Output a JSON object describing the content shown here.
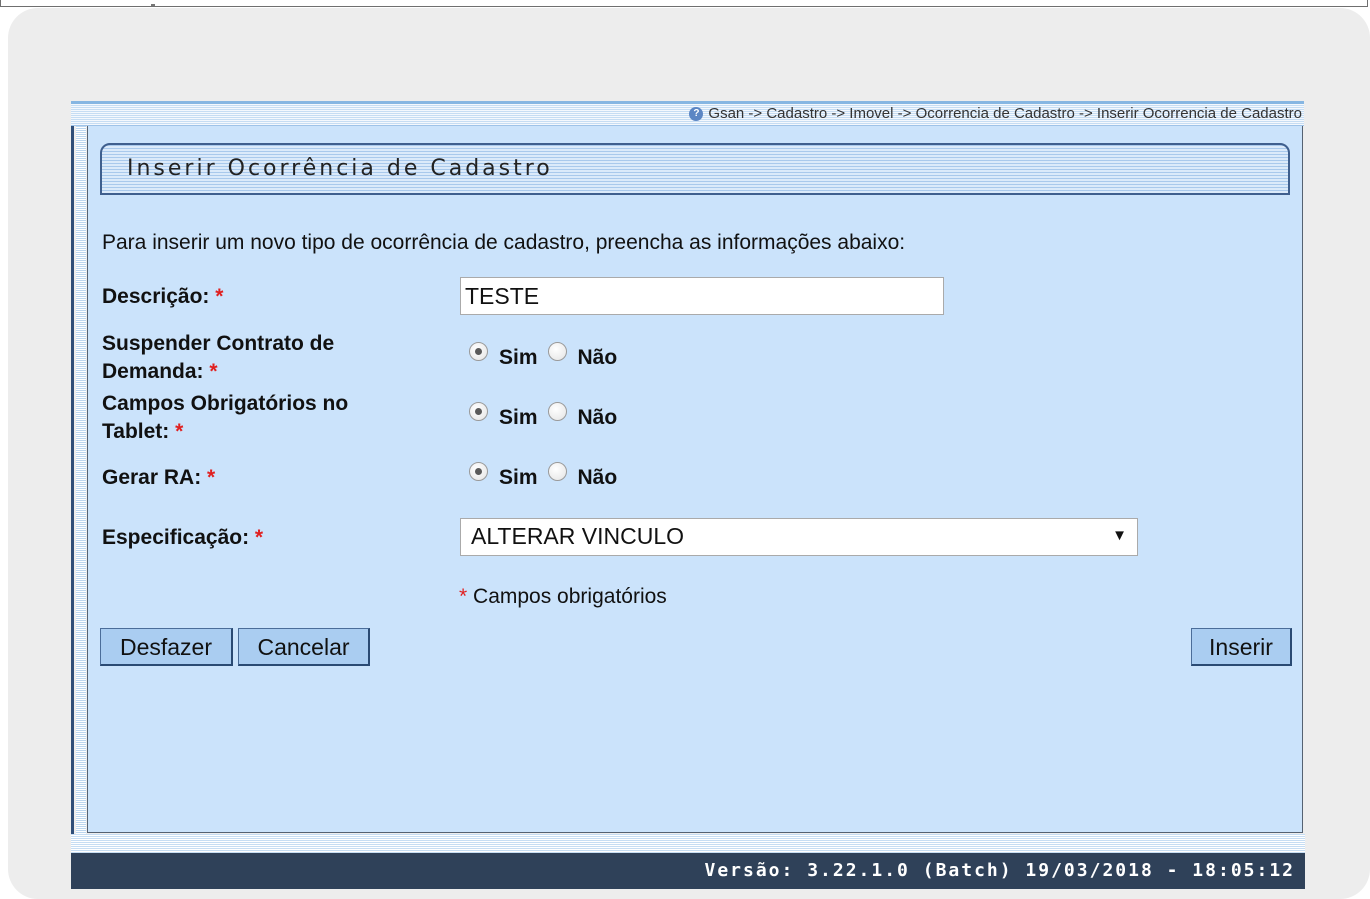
{
  "breadcrumb": "Gsan -> Cadastro -> Imovel -> Ocorrencia de Cadastro -> Inserir Ocorrencia de Cadastro",
  "page_title": "Inserir Ocorrência de Cadastro",
  "intro_text": "Para inserir um novo tipo de ocorrência de cadastro, preencha as informações abaixo:",
  "required_marker": "*",
  "fields": {
    "descricao": {
      "label": "Descrição:",
      "value": "TESTE"
    },
    "suspender": {
      "label_line1": "Suspender Contrato de",
      "label_line2": "Demanda:",
      "selected": "Sim"
    },
    "campos": {
      "label_line1": "Campos Obrigatórios no",
      "label_line2": "Tablet:",
      "selected": "Sim"
    },
    "gerar_ra": {
      "label": "Gerar RA:",
      "selected": "Sim"
    },
    "especificacao": {
      "label": "Especificação:",
      "value": "ALTERAR VINCULO"
    }
  },
  "radio_options": {
    "yes": "Sim",
    "no": "Não"
  },
  "required_note": "Campos obrigatórios",
  "buttons": {
    "undo": "Desfazer",
    "cancel": "Cancelar",
    "insert": "Inserir"
  },
  "footer_version": "Versão: 3.22.1.0 (Batch) 19/03/2018 - 18:05:12",
  "colors": {
    "panel_bg": "#cbe3fb",
    "footer_bg": "#2f4159",
    "required": "#e02020",
    "button_bg": "#aacdf1"
  },
  "icons": {
    "help": "help-icon",
    "dropdown": "chevron-down-icon"
  }
}
